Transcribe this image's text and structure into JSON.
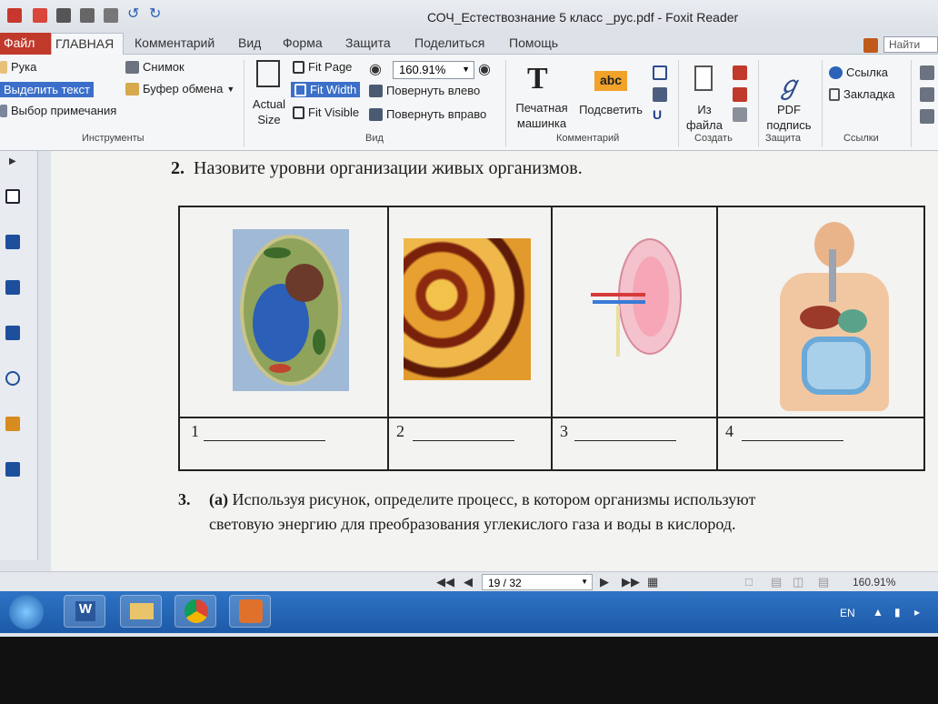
{
  "window": {
    "title": "СОЧ_Естествознание 5 класс _рус.pdf - Foxit Reader"
  },
  "tabs": {
    "file": "Файл",
    "home": "ГЛАВНАЯ",
    "comment": "Комментарий",
    "view": "Вид",
    "form": "Форма",
    "protect": "Защита",
    "share": "Поделиться",
    "help": "Помощь",
    "search_placeholder": "Найти"
  },
  "ribbon": {
    "tools": {
      "hand": "Рука",
      "select_text": "Выделить текст",
      "select_annotation": "Выбор примечания",
      "snapshot": "Снимок",
      "clipboard": "Буфер обмена",
      "group_label": "Инструменты"
    },
    "view": {
      "actual_size_1": "Actual",
      "actual_size_2": "Size",
      "fit_page": "Fit Page",
      "fit_width": "Fit Width",
      "fit_visible": "Fit Visible",
      "zoom_value": "160.91%",
      "rotate_left": "Повернуть влево",
      "rotate_right": "Повернуть вправо",
      "group_label": "Вид"
    },
    "comment": {
      "typewriter_1": "Печатная",
      "typewriter_2": "машинка",
      "highlight": "Подсветить",
      "abc": "abc",
      "group_label": "Комментарий"
    },
    "create": {
      "from_file_1": "Из",
      "from_file_2": "файла",
      "group_label": "Создать"
    },
    "protect": {
      "pdf_sign_1": "PDF",
      "pdf_sign_2": "подпись",
      "group_label": "Защита"
    },
    "links": {
      "link": "Ссылка",
      "bookmark": "Закладка",
      "group_label": "Ссылки"
    }
  },
  "document": {
    "q2_number": "2.",
    "q2_text": "Назовите уровни организации живых организмов.",
    "cells": [
      "1",
      "2",
      "3",
      "4"
    ],
    "q3_number": "3.",
    "q3_part": "(a)",
    "q3_line1": "Используя рисунок, определите процесс, в котором организмы используют",
    "q3_line2": "световую энергию для преобразования углекислого газа и воды в кислород."
  },
  "status": {
    "page": "19 / 32",
    "zoom": "160.91%"
  },
  "taskbar": {
    "language": "EN"
  }
}
